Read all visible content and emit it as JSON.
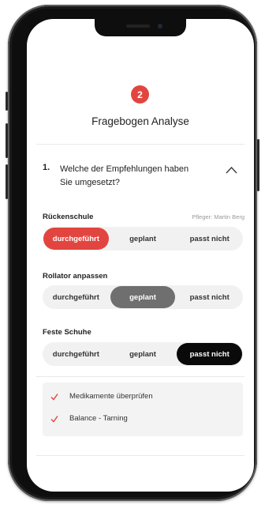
{
  "step": {
    "number": "2"
  },
  "header": {
    "title": "Fragebogen Analyse"
  },
  "question": {
    "number": "1.",
    "text": "Welche der Empfehlungen haben Sie umgesetzt?"
  },
  "items": [
    {
      "label": "Rückenschule",
      "helper": "Pfleger: Martin Berg",
      "options": [
        "durchgeführt",
        "geplant",
        "passt nicht"
      ],
      "selected": "durchgeführt"
    },
    {
      "label": "Rollator anpassen",
      "options": [
        "durchgeführt",
        "geplant",
        "passt nicht"
      ],
      "selected": "geplant"
    },
    {
      "label": "Feste Schuhe",
      "options": [
        "durchgeführt",
        "geplant",
        "passt nicht"
      ],
      "selected": "passt nicht"
    }
  ],
  "checklist": [
    "Medikamente überprüfen",
    "Balance - Tarning"
  ],
  "colors": {
    "accent": "#e2453f",
    "selected_gray": "#6f6f6f",
    "selected_black": "#0a0a0a"
  }
}
